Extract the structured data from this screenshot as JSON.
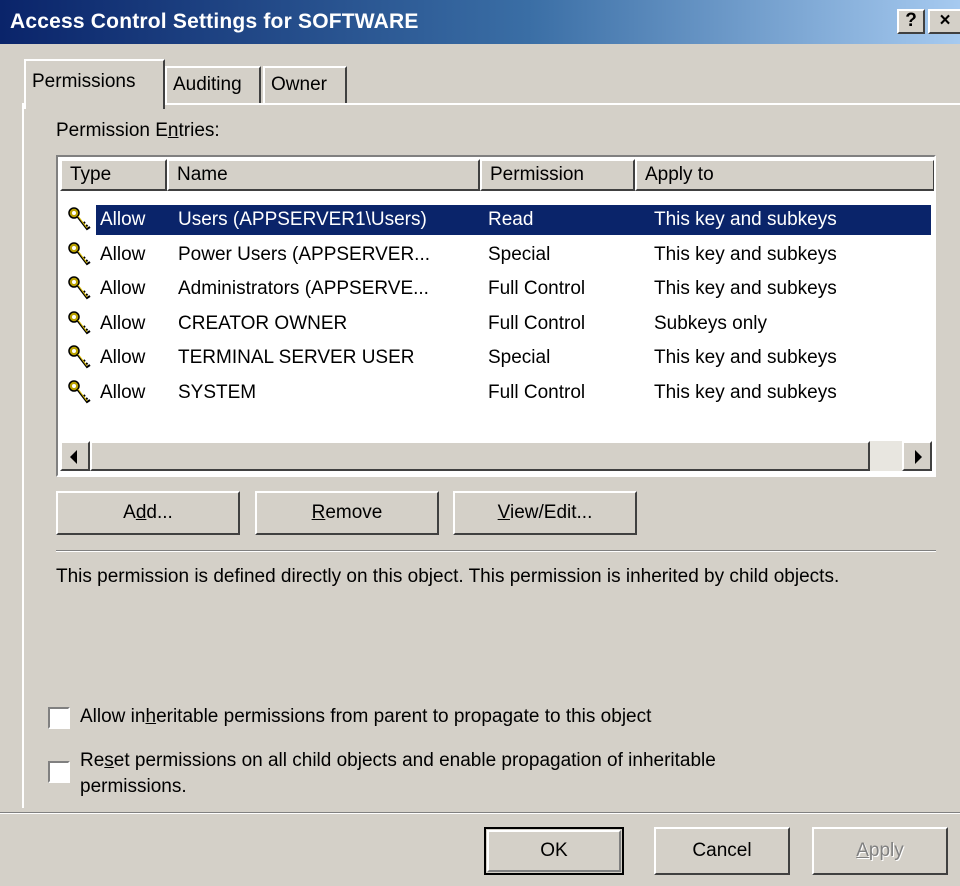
{
  "window": {
    "title": "Access Control Settings for SOFTWARE",
    "help_label": "?",
    "close_label": "×"
  },
  "tabs": [
    {
      "label": "Permissions",
      "active": true
    },
    {
      "label": "Auditing",
      "active": false
    },
    {
      "label": "Owner",
      "active": false
    }
  ],
  "permission_entries": {
    "label_pre": "Permission E",
    "label_u": "n",
    "label_post": "tries:",
    "columns": [
      "Type",
      "Name",
      "Permission",
      "Apply to"
    ],
    "rows": [
      {
        "type": "Allow",
        "name": "Users (APPSERVER1\\Users)",
        "permission": "Read",
        "apply_to": "This key and subkeys",
        "icon": "key-icon",
        "selected": true
      },
      {
        "type": "Allow",
        "name": "Power Users (APPSERVER...",
        "permission": "Special",
        "apply_to": "This key and subkeys",
        "icon": "key-icon",
        "selected": false
      },
      {
        "type": "Allow",
        "name": "Administrators (APPSERVE...",
        "permission": "Full Control",
        "apply_to": "This key and subkeys",
        "icon": "key-icon",
        "selected": false
      },
      {
        "type": "Allow",
        "name": "CREATOR OWNER",
        "permission": "Full Control",
        "apply_to": "Subkeys only",
        "icon": "key-icon",
        "selected": false
      },
      {
        "type": "Allow",
        "name": "TERMINAL SERVER USER",
        "permission": "Special",
        "apply_to": "This key and subkeys",
        "icon": "key-icon",
        "selected": false
      },
      {
        "type": "Allow",
        "name": "SYSTEM",
        "permission": "Full Control",
        "apply_to": "This key and subkeys",
        "icon": "key-icon",
        "selected": false
      }
    ]
  },
  "buttons": {
    "add": {
      "pre": "A",
      "u": "d",
      "post": "d..."
    },
    "remove": {
      "pre": "",
      "u": "R",
      "post": "emove"
    },
    "view_edit": {
      "pre": "",
      "u": "V",
      "post": "iew/Edit..."
    },
    "ok": "OK",
    "cancel": "Cancel",
    "apply": {
      "pre": "",
      "u": "A",
      "post": "pply"
    }
  },
  "description": "This permission is defined directly on this object. This permission is inherited by child objects.",
  "options": {
    "inherit": {
      "pre": "Allow in",
      "u": "h",
      "post": "eritable permissions from parent to propagate to this object",
      "checked": false
    },
    "reset": {
      "pre": "Re",
      "u": "s",
      "post": "et permissions on all child objects and enable propagation of inheritable",
      "line2": "permissions.",
      "checked": false
    }
  },
  "colors": {
    "title_gradient_start": "#0a246a",
    "title_gradient_end": "#a6caf0",
    "selection": "#0a246a",
    "face": "#d4d0c8"
  }
}
